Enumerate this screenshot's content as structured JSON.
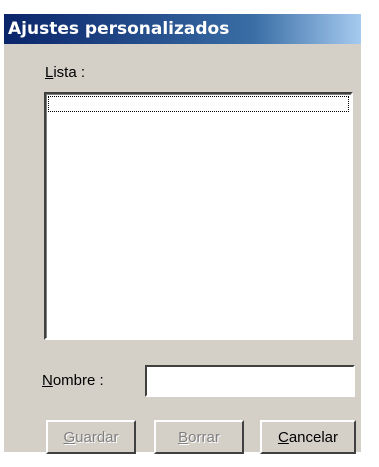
{
  "dialog": {
    "title": "Ajustes personalizados"
  },
  "list": {
    "label": "Lista :",
    "items": []
  },
  "name": {
    "label": "Nombre :",
    "value": ""
  },
  "buttons": {
    "save": "Guardar",
    "delete": "Borrar",
    "cancel": "Cancelar"
  },
  "colors": {
    "titlebar_start": "#0a246a",
    "titlebar_end": "#a6caf0",
    "dialog_face": "#d4d0c8"
  }
}
